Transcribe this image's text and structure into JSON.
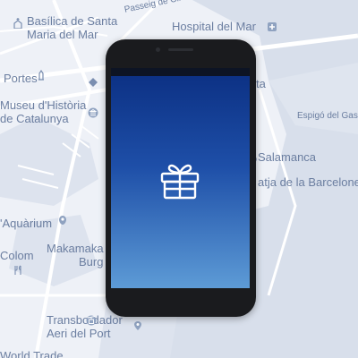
{
  "map": {
    "labels": {
      "basilica": "Basílica de Santa",
      "basilica2": "Maria del Mar",
      "passeig": "Passeig de Circum",
      "hospital": "Hospital del Mar",
      "portes": "Portes",
      "museu1": "Museu d'Història",
      "museu2": "de Catalunya",
      "plataforma": "ta",
      "espigo": "Espigó del Gas",
      "salamanca": "Salamanca",
      "platja": "atja de la Barcelone",
      "aquarium": "'Aquàrium",
      "colom": "Colom",
      "makamaka1": "Makamaka",
      "makamaka2": "Burg",
      "transbordador1": "Transbordador",
      "transbordador2": "Aeri del Port",
      "worldtrade": "World Trade"
    },
    "colors": {
      "land": "#eef1f7",
      "water": "#d8dfeb",
      "road": "#ffffff",
      "label": "#6b7ea0"
    }
  },
  "phone": {
    "screen_icon": "gift-icon",
    "colors": {
      "gradient_top": "#0b2f82",
      "gradient_bottom": "#5d9bd6",
      "body": "#1a1b1e"
    }
  }
}
